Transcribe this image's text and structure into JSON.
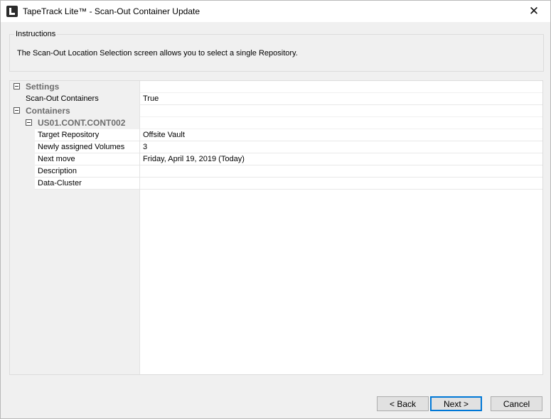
{
  "window": {
    "title": "TapeTrack Lite™ - Scan-Out Container Update",
    "close_glyph": "✕"
  },
  "instructions": {
    "legend": "Instructions",
    "text": "The Scan-Out Location Selection screen allows you to select a single Repository."
  },
  "grid": {
    "settings": {
      "label": "Settings",
      "rows": [
        {
          "name": "Scan-Out Containers",
          "value": "True"
        }
      ]
    },
    "containers": {
      "label": "Containers",
      "container": {
        "label": "US01.CONT.CONT002",
        "rows": [
          {
            "name": "Target Repository",
            "value": "Offsite Vault"
          },
          {
            "name": "Newly assigned Volumes",
            "value": "3"
          },
          {
            "name": "Next move",
            "value": "Friday, April 19, 2019 (Today)"
          },
          {
            "name": "Description",
            "value": ""
          },
          {
            "name": "Data-Cluster",
            "value": ""
          }
        ]
      }
    }
  },
  "buttons": {
    "back": "< Back",
    "next": "Next >",
    "cancel": "Cancel"
  },
  "icons": {
    "app": "tapetrack-app-icon",
    "close": "close-icon",
    "collapse": "collapse-minus-icon"
  }
}
